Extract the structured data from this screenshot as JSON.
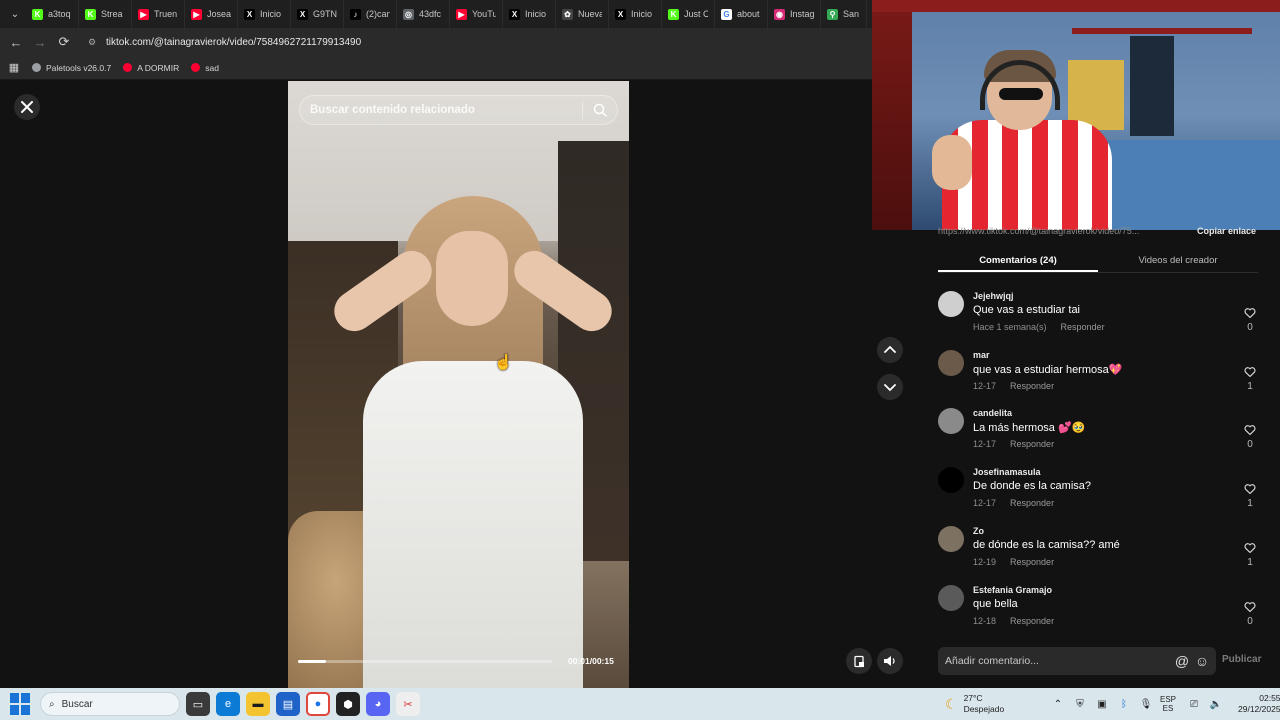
{
  "browser": {
    "tabs": [
      {
        "label": "a3toq",
        "icon": "kick-icon",
        "color": "#53fc18",
        "glyph": "K"
      },
      {
        "label": "Strea",
        "icon": "kick-icon",
        "color": "#53fc18",
        "glyph": "K"
      },
      {
        "label": "Truen",
        "icon": "youtube-icon",
        "color": "#ff0033",
        "glyph": "▶"
      },
      {
        "label": "Josea",
        "icon": "youtube-icon",
        "color": "#ff0033",
        "glyph": "▶"
      },
      {
        "label": "Inicio",
        "icon": "x-icon",
        "color": "#000000",
        "glyph": "X"
      },
      {
        "label": "G9TN",
        "icon": "x-icon",
        "color": "#000000",
        "glyph": "X"
      },
      {
        "label": "(2)can",
        "icon": "tiktok-icon",
        "color": "#000000",
        "glyph": "♪"
      },
      {
        "label": "43dfc",
        "icon": "globe-icon",
        "color": "#5f6368",
        "glyph": "◎"
      },
      {
        "label": "YouTu",
        "icon": "youtube-icon",
        "color": "#ff0033",
        "glyph": "▶"
      },
      {
        "label": "Inicio",
        "icon": "x-icon",
        "color": "#000000",
        "glyph": "X"
      },
      {
        "label": "Nueva",
        "icon": "openai-icon",
        "color": "#444444",
        "glyph": "✿"
      },
      {
        "label": "Inicio",
        "icon": "x-icon",
        "color": "#000000",
        "glyph": "X"
      },
      {
        "label": "Just C",
        "icon": "kick-icon",
        "color": "#53fc18",
        "glyph": "K"
      },
      {
        "label": "about",
        "icon": "google-icon",
        "color": "#ffffff",
        "glyph": "G"
      },
      {
        "label": "Instag",
        "icon": "instagram-icon",
        "color": "#d62976",
        "glyph": "◉"
      },
      {
        "label": "San Ju",
        "icon": "maps-icon",
        "color": "#34a853",
        "glyph": "⚲"
      }
    ],
    "url": "tiktok.com/@tainagravierok/video/7584962721179913490",
    "bookmarks": [
      {
        "label": "Paletools v26.0.7",
        "icon": "globe-icon",
        "color": "#9aa0a6"
      },
      {
        "label": "A DORMIR",
        "icon": "youtube-icon",
        "color": "#ff0033"
      },
      {
        "label": "sad",
        "icon": "youtube-icon",
        "color": "#ff0033"
      }
    ]
  },
  "video": {
    "search_placeholder": "Buscar contenido relacionado",
    "time": "00:01/00:15",
    "progress": 0.11
  },
  "panel": {
    "video_url": "https://www.tiktok.com/@tainagravierok/video/75...",
    "copy_link": "Copiar enlace",
    "tabs": [
      "Comentarios (24)",
      "Videos del creador"
    ],
    "reply_label": "Responder",
    "comments": [
      {
        "author": "Jejehwjqj",
        "text": "Que vas a estudiar tai",
        "date": "Hace 1 semana(s)",
        "likes": "0",
        "avatar": "#cfcfcf"
      },
      {
        "author": "mar",
        "text": "que vas a estudiar hermosa💖",
        "date": "12-17",
        "likes": "1",
        "avatar": "#6b5a4a"
      },
      {
        "author": "candelita",
        "text": "La más hermosa 💕🥹",
        "date": "12-17",
        "likes": "0",
        "avatar": "#8a8a8a"
      },
      {
        "author": "Josefinamasula",
        "text": "De donde es la camisa?",
        "date": "12-17",
        "likes": "1",
        "avatar": "#000000"
      },
      {
        "author": "Zo",
        "text": "de dónde es la camisa?? amé",
        "date": "12-19",
        "likes": "1",
        "avatar": "#7d7262"
      },
      {
        "author": "Estefania Gramajo",
        "text": "que bella",
        "date": "12-18",
        "likes": "0",
        "avatar": "#5a5a5a"
      }
    ],
    "comment_placeholder": "Añadir comentario...",
    "publish": "Publicar"
  },
  "taskbar": {
    "search": "Buscar",
    "weather_temp": "27°C",
    "weather_desc": "Despejado",
    "lang_top": "ESP",
    "lang_bottom": "ES",
    "time": "02:55",
    "date": "29/12/2025"
  }
}
